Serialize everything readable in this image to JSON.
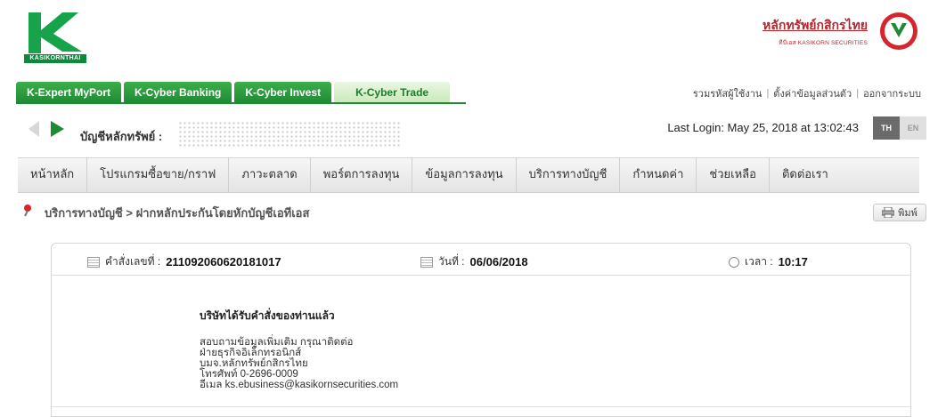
{
  "logo": {
    "text": "KASIKORNTHAI"
  },
  "brand": {
    "name": "หลักทรัพย์กสิกรไทย",
    "sub": "ทีบีเอส KASIKORN SECURITIES"
  },
  "product_tabs": [
    {
      "label": "K-Expert MyPort",
      "active": false
    },
    {
      "label": "K-Cyber Banking",
      "active": false
    },
    {
      "label": "K-Cyber Invest",
      "active": false
    },
    {
      "label": "K-Cyber Trade",
      "active": true
    }
  ],
  "top_links": [
    "รวมรหัสผู้ใช้งาน",
    "ตั้งค่าข้อมูลส่วนตัว",
    "ออกจากระบบ"
  ],
  "account": {
    "label": "บัญชีหลักทรัพย์ :"
  },
  "last_login": "Last Login: May 25, 2018 at 13:02:43",
  "lang": {
    "th": "TH",
    "en": "EN"
  },
  "main_nav": [
    "หน้าหลัก",
    "โปรแกรมซื้อขาย/กราฟ",
    "ภาวะตลาด",
    "พอร์ตการลงทุน",
    "ข้อมูลการลงทุน",
    "บริการทางบัญชี",
    "กำหนดค่า",
    "ช่วยเหลือ",
    "ติดต่อเรา"
  ],
  "breadcrumb": "บริการทางบัญชี > ฝากหลักประกันโดยหักบัญชีเอทีเอส",
  "print_label": "พิมพ์",
  "order": {
    "number_label": "คำสั่งเลขที่ :",
    "number_value": "211092060620181017",
    "date_label": "วันที่ :",
    "date_value": "06/06/2018",
    "time_label": "เวลา :",
    "time_value": "10:17"
  },
  "message": {
    "title": "บริษัทได้รับคำสั่งของท่านแล้ว",
    "lines": [
      "สอบถามข้อมูลเพิ่มเติม กรุณาติดต่อ",
      "ฝ่ายธุรกิจอิเล็กทรอนิกส์",
      "บมจ.หลักทรัพย์กสิกรไทย",
      "โทรศัพท์ 0-2696-0009",
      "อีเมล ks.ebusiness@kasikornsecurities.com"
    ]
  },
  "colors": {
    "green": "#1f8a34",
    "brand_red": "#b3272d"
  }
}
